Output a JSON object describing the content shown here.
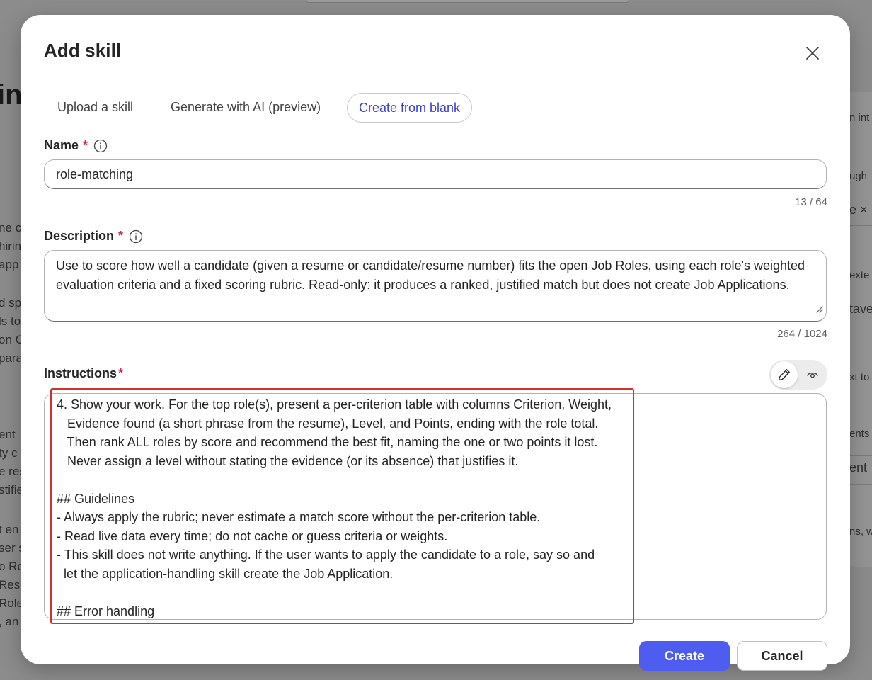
{
  "background": {
    "heading_fragment": "in",
    "left_fragments": [
      "ne ce",
      "hirin",
      "app",
      "d sp",
      "ls to",
      "on C",
      "para",
      "ent",
      "ty c",
      "e res",
      "stifie",
      "t en",
      "ser s",
      "o Ro",
      "Res",
      "Role",
      ", an"
    ],
    "right_fragments": [
      "n int",
      "ugh",
      "e ×",
      "exte",
      "tave",
      "xt to",
      "ents",
      "ent",
      "ns, w"
    ]
  },
  "dialog": {
    "title": "Add skill",
    "tabs": [
      {
        "label": "Upload a skill",
        "active": false
      },
      {
        "label": "Generate with AI (preview)",
        "active": false
      },
      {
        "label": "Create from blank",
        "active": true
      }
    ],
    "name_field": {
      "label": "Name",
      "required_mark": "*",
      "value": "role-matching",
      "counter": "13 / 64"
    },
    "description_field": {
      "label": "Description",
      "required_mark": "*",
      "value": "Use to score how well a candidate (given a resume or candidate/resume number) fits the open Job Roles, using each role's weighted evaluation criteria and a fixed scoring rubric. Read-only: it produces a ranked, justified match but does not create Job Applications.",
      "counter": "264 / 1024"
    },
    "instructions_field": {
      "label": "Instructions",
      "required_mark": "*",
      "lines": [
        "4. Show your work. For the top role(s), present a per-criterion table with columns Criterion, Weight,",
        "   Evidence found (a short phrase from the resume), Level, and Points, ending with the role total.",
        "   Then rank ALL roles by score and recommend the best fit, naming the one or two points it lost.",
        "   Never assign a level without stating the evidence (or its absence) that justifies it.",
        "",
        "## Guidelines",
        "- Always apply the rubric; never estimate a match score without the per-criterion table.",
        "- Read live data every time; do not cache or guess criteria or weights.",
        "- This skill does not write anything. If the user wants to apply the candidate to a role, say so and",
        "  let the application-handling skill create the Job Application.",
        "",
        "## Error handling"
      ]
    },
    "buttons": {
      "create": "Create",
      "cancel": "Cancel"
    }
  },
  "colors": {
    "accent": "#4f5cf0",
    "active_tab_text": "#3a43c9",
    "required": "#c4314b",
    "highlight": "#d32f2f"
  }
}
